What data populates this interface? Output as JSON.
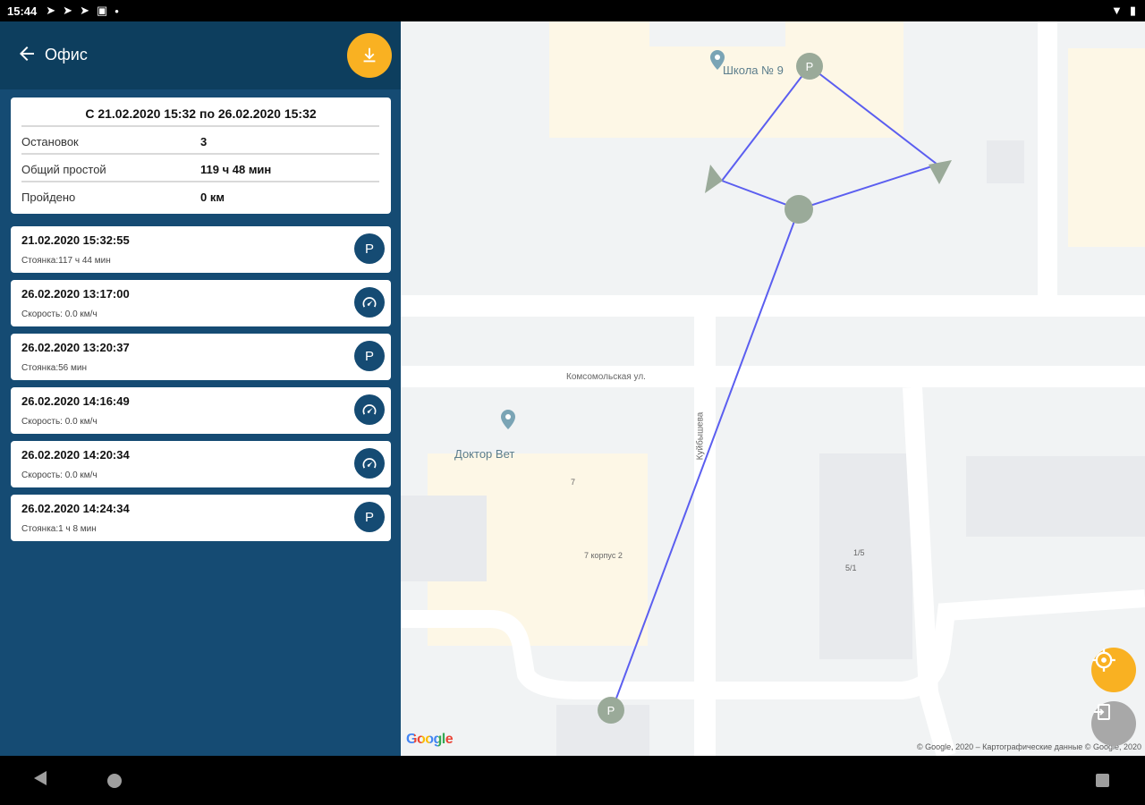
{
  "status_bar": {
    "time": "15:44"
  },
  "header": {
    "title": "Офис"
  },
  "summary": {
    "period": "С 21.02.2020 15:32 по 26.02.2020 15:32",
    "rows": [
      {
        "label": "Остановок",
        "value": "3"
      },
      {
        "label": "Общий простой",
        "value": "119 ч 48 мин"
      },
      {
        "label": "Пройдено",
        "value": "0 км"
      }
    ]
  },
  "events": [
    {
      "datetime": "21.02.2020 15:32:55",
      "detail": "Стоянка:117 ч 44 мин",
      "badge": "P",
      "icon": "parking-icon"
    },
    {
      "datetime": "26.02.2020 13:17:00",
      "detail": "Скорость: 0.0 км/ч",
      "badge": "",
      "icon": "speedometer-icon"
    },
    {
      "datetime": "26.02.2020 13:20:37",
      "detail": "Стоянка:56 мин",
      "badge": "P",
      "icon": "parking-icon"
    },
    {
      "datetime": "26.02.2020 14:16:49",
      "detail": "Скорость: 0.0 км/ч",
      "badge": "",
      "icon": "speedometer-icon"
    },
    {
      "datetime": "26.02.2020 14:20:34",
      "detail": "Скорость: 0.0 км/ч",
      "badge": "",
      "icon": "speedometer-icon"
    },
    {
      "datetime": "26.02.2020 14:24:34",
      "detail": "Стоянка:1 ч 8 мин",
      "badge": "P",
      "icon": "parking-icon"
    }
  ],
  "map": {
    "poi_school": "Школа № 9",
    "poi_vet": "Доктор Вет",
    "street_komsomolskaya": "Комсомольская ул.",
    "street_kuibysheva": "Куйбышева",
    "bld_7": "7",
    "bld_7k2": "7 корпус 2",
    "bld_1_5": "1/5",
    "bld_5_1": "5/1",
    "logo": "Google",
    "copyright": "© Google, 2020 – Картографические данные © Google, 2020",
    "marker_label": "P"
  },
  "colors": {
    "accent": "#f9b122",
    "panel": "#154b73",
    "appbar": "#0d3e5e",
    "route": "#5b5ef0",
    "marker": "#9aaa99"
  }
}
